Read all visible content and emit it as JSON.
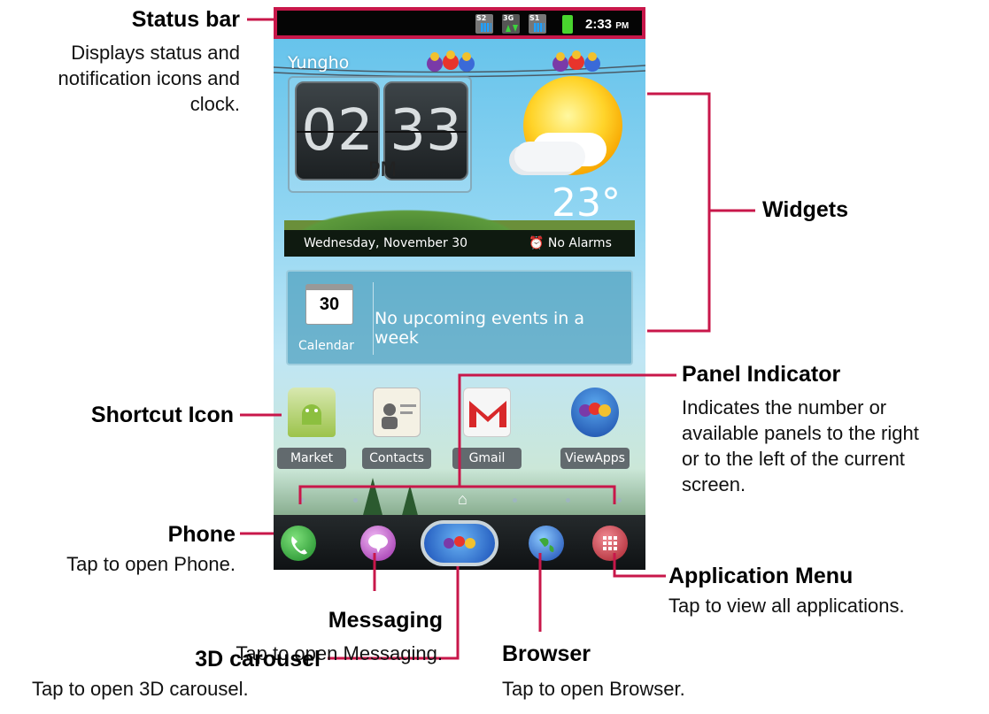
{
  "status_bar": {
    "time": "2:33",
    "ampm": "PM",
    "icons": [
      "signal-s2-icon",
      "data-3g-icon",
      "signal-s1-icon",
      "battery-icon"
    ],
    "signal_labels": [
      "S2",
      "3G",
      "S1"
    ]
  },
  "clock_widget": {
    "city": "Yungho",
    "hour": "02",
    "minute": "33",
    "ampm": "PM",
    "temperature": "23°",
    "date": "Wednesday, November 30",
    "alarm": "No Alarms"
  },
  "calendar_widget": {
    "day": "30",
    "label": "Calendar",
    "message": "No upcoming events in a week"
  },
  "shortcuts": [
    {
      "label": "Market",
      "icon": "market-bag-icon"
    },
    {
      "label": "Contacts",
      "icon": "contacts-card-icon"
    },
    {
      "label": "Gmail",
      "icon": "gmail-envelope-icon"
    },
    {
      "label": "ViewApps",
      "icon": "viewapps-birds-icon"
    }
  ],
  "dock": [
    "phone-icon",
    "messaging-icon",
    "carousel-3d-icon",
    "browser-globe-icon",
    "app-menu-grid-icon"
  ],
  "annotations": {
    "status_bar": {
      "title": "Status bar",
      "desc": "Displays status and notification icons and clock."
    },
    "widgets": {
      "title": "Widgets"
    },
    "shortcut": {
      "title": "Shortcut Icon"
    },
    "panel": {
      "title": "Panel Indicator",
      "desc": "Indicates the number or available panels to the right or to the left of the current screen."
    },
    "phone": {
      "title": "Phone",
      "desc": "Tap to open Phone."
    },
    "messaging": {
      "title": "Messaging",
      "desc": "Tap to open Messaging."
    },
    "carousel": {
      "title": "3D carousel",
      "desc": "Tap to open 3D carousel."
    },
    "browser": {
      "title": "Browser",
      "desc": "Tap to open Browser."
    },
    "app_menu": {
      "title": "Application Menu",
      "desc": "Tap to view all applications."
    }
  },
  "colors": {
    "callout_line": "#c8174a",
    "status_bar_bg": "#050505"
  }
}
